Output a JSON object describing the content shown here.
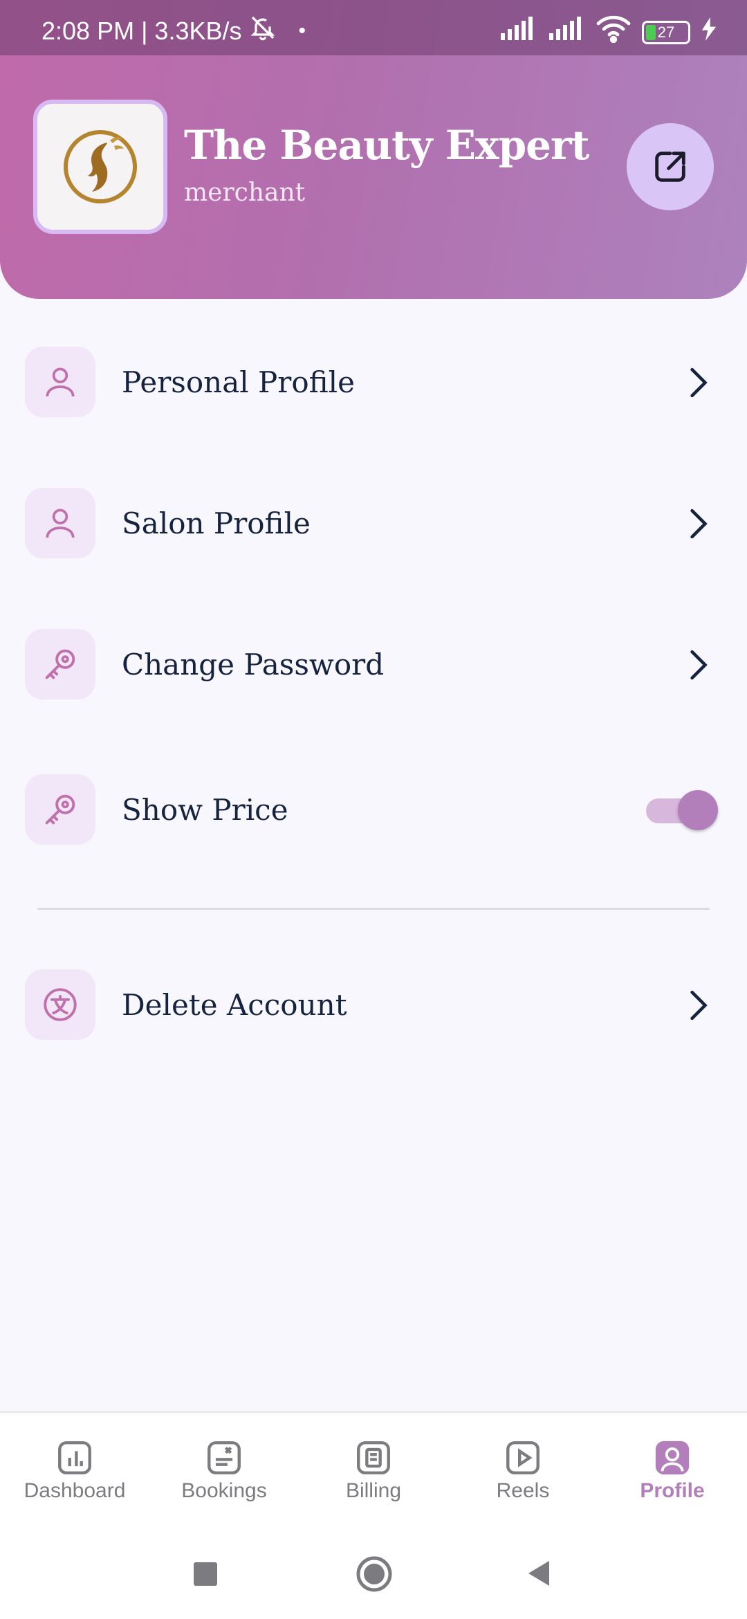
{
  "status_bar": {
    "time_speed": "2:08 PM | 3.3KB/s",
    "battery": "27"
  },
  "header": {
    "title": "The Beauty Expert",
    "subtitle": "merchant"
  },
  "menu": {
    "personal_profile": "Personal Profile",
    "salon_profile": "Salon Profile",
    "change_password": "Change Password",
    "show_price": "Show Price",
    "show_price_enabled": true,
    "delete_account": "Delete Account"
  },
  "bottom_nav": {
    "items": [
      {
        "label": "Dashboard",
        "icon": "chart-icon"
      },
      {
        "label": "Bookings",
        "icon": "scissors-receipt-icon"
      },
      {
        "label": "Billing",
        "icon": "bill-icon"
      },
      {
        "label": "Reels",
        "icon": "play-icon"
      },
      {
        "label": "Profile",
        "icon": "user-icon"
      }
    ],
    "active": "Profile"
  },
  "colors": {
    "accent": "#b27fba",
    "header_start": "#c06aaa",
    "header_end": "#ad82bd",
    "text_dark": "#15233f"
  }
}
